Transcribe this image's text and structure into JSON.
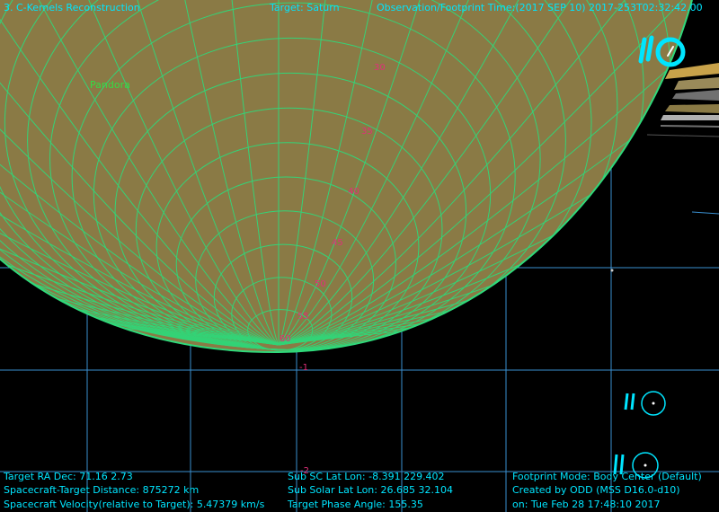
{
  "header": {
    "title": "3. C-Kernels Reconstruction",
    "target": "Target: Saturn",
    "observation_time": "Observation/Footprint Time:(2017 SEP 10) 2017-253T02:32:42.00"
  },
  "scene": {
    "moon_label": "Pandora",
    "latitude_labels": [
      "30",
      "35",
      "40",
      "45",
      "50",
      "55",
      "60"
    ],
    "grid_tick_labels": [
      "-1",
      "-2"
    ],
    "colors": {
      "background": "#000000",
      "planet_fill": "#8a7a45",
      "planet_grid": "#2fd97a",
      "grid_lines": "#3a8fd0",
      "latitude_label": "#e0307a",
      "moon_label": "#33dd44",
      "hud_text": "#00e5ff",
      "rings": "#c8a24a"
    },
    "icons": [
      "moon-glyph-icon",
      "sun-marker-icon",
      "spacecraft-marker-icon"
    ]
  },
  "footer": {
    "left": [
      "Target RA Dec: 71.16   2.73",
      "Spacecraft-Target Distance:  875272 km",
      "Spacecraft Velocity(relative to Target): 5.47379 km/s"
    ],
    "middle": [
      "Sub SC Lat Lon: -8.391  229.402",
      "Sub Solar Lat Lon: 26.685  32.104",
      "Target Phase Angle: 155.35"
    ],
    "right": [
      "Footprint Mode: Body Center (Default)",
      "Created by ODD (MSS D16.0-d10)",
      "on: Tue Feb 28 17:48:10 2017"
    ]
  }
}
